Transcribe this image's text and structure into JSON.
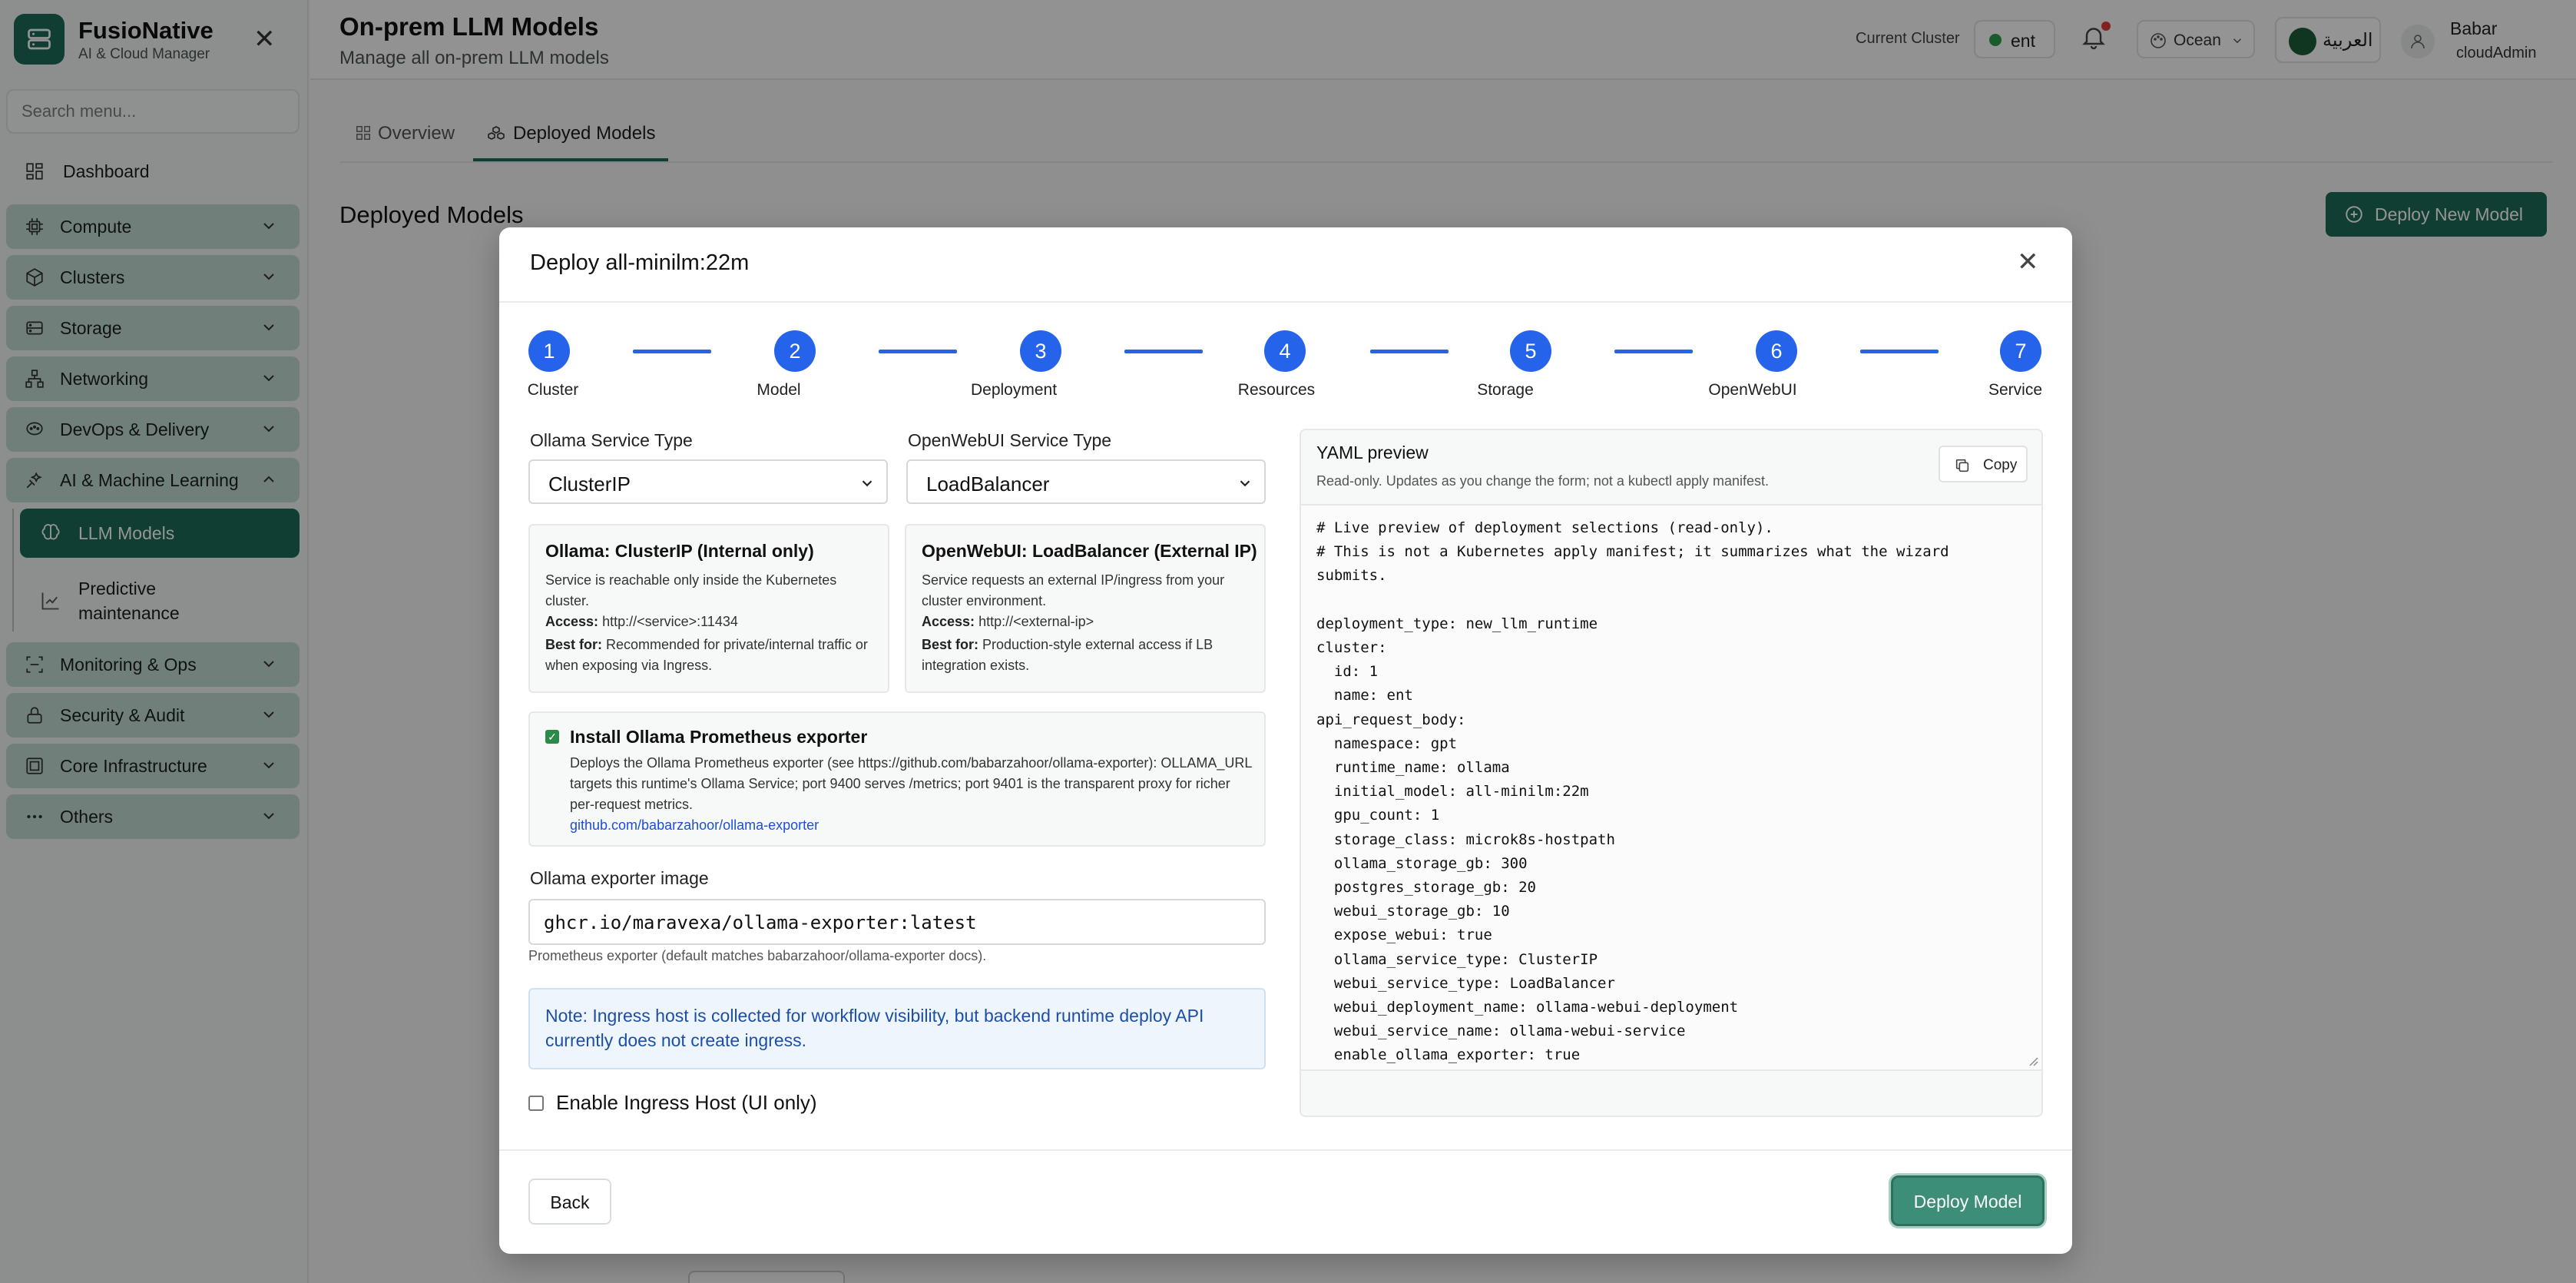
{
  "app": {
    "brand_name": "FusioNative",
    "brand_sub": "AI & Cloud Manager",
    "search_placeholder": "Search menu..."
  },
  "sidebar": {
    "dashboard": "Dashboard",
    "groups": [
      {
        "label": "Compute",
        "icon": "cpu-icon"
      },
      {
        "label": "Clusters",
        "icon": "cube-icon"
      },
      {
        "label": "Storage",
        "icon": "database-icon"
      },
      {
        "label": "Networking",
        "icon": "network-icon"
      },
      {
        "label": "DevOps & Delivery",
        "icon": "devops-icon"
      },
      {
        "label": "AI & Machine Learning",
        "icon": "ai-icon"
      },
      {
        "label": "Monitoring & Ops",
        "icon": "monitor-icon"
      },
      {
        "label": "Security & Audit",
        "icon": "lock-icon"
      },
      {
        "label": "Core Infrastructure",
        "icon": "server-icon"
      },
      {
        "label": "Others",
        "icon": "dots-icon"
      }
    ],
    "active_item": "LLM Models",
    "sub_item": "Predictive maintenance"
  },
  "header": {
    "title": "On-prem LLM Models",
    "subtitle": "Manage all on-prem LLM models",
    "current_cluster_label": "Current Cluster",
    "cluster_name": "ent",
    "theme": "Ocean",
    "language": "العربية",
    "user_name": "Babar",
    "user_role": "cloudAdmin"
  },
  "tabs": {
    "overview": "Overview",
    "deployed": "Deployed Models"
  },
  "main": {
    "section_title": "Deployed Models",
    "deploy_new": "Deploy New Model"
  },
  "modal": {
    "title": "Deploy all-minilm:22m",
    "steps": [
      "Cluster",
      "Model",
      "Deployment",
      "Resources",
      "Storage",
      "OpenWebUI",
      "Service"
    ],
    "step_numbers": [
      "1",
      "2",
      "3",
      "4",
      "5",
      "6",
      "7"
    ],
    "ollama_service_label": "Ollama Service Type",
    "ollama_service_value": "ClusterIP",
    "webui_service_label": "OpenWebUI Service Type",
    "webui_service_value": "LoadBalancer",
    "ollama_card": {
      "heading": "Ollama: ClusterIP (Internal only)",
      "desc": "Service is reachable only inside the Kubernetes cluster.",
      "access_label": "Access:",
      "access_value": "http://<service>:11434",
      "best_label": "Best for:",
      "best_value": "Recommended for private/internal traffic or when exposing via Ingress."
    },
    "webui_card": {
      "heading": "OpenWebUI: LoadBalancer (External IP)",
      "desc": "Service requests an external IP/ingress from your cluster environment.",
      "access_label": "Access:",
      "access_value": "http://<external-ip>",
      "best_label": "Best for:",
      "best_value": "Production-style external access if LB integration exists."
    },
    "exporter": {
      "label": "Install Ollama Prometheus exporter",
      "checked": true,
      "desc": "Deploys the Ollama Prometheus exporter (see https://github.com/babarzahoor/ollama-exporter): OLLAMA_URL targets this runtime's Ollama Service; port 9400 serves /metrics; port 9401 is the transparent proxy for richer per-request metrics.",
      "link": "github.com/babarzahoor/ollama-exporter"
    },
    "image_label": "Ollama exporter image",
    "image_value": "ghcr.io/maravexa/ollama-exporter:latest",
    "image_hint": "Prometheus exporter (default matches babarzahoor/ollama-exporter docs).",
    "note": "Note: Ingress host is collected for workflow visibility, but backend runtime deploy API currently does not create ingress.",
    "ingress_label": "Enable Ingress Host (UI only)",
    "ingress_checked": false,
    "yaml": {
      "title": "YAML preview",
      "subtitle": "Read-only. Updates as you change the form; not a kubectl apply manifest.",
      "copy": "Copy",
      "lines": [
        "# Live preview of deployment selections (read-only).",
        "# This is not a Kubernetes apply manifest; it summarizes what the wizard",
        "submits.",
        "",
        "deployment_type: new_llm_runtime",
        "cluster:",
        "  id: 1",
        "  name: ent",
        "api_request_body:",
        "  namespace: gpt",
        "  runtime_name: ollama",
        "  initial_model: all-minilm:22m",
        "  gpu_count: 1",
        "  storage_class: microk8s-hostpath",
        "  ollama_storage_gb: 300",
        "  postgres_storage_gb: 20",
        "  webui_storage_gb: 10",
        "  expose_webui: true",
        "  ollama_service_type: ClusterIP",
        "  webui_service_type: LoadBalancer",
        "  webui_deployment_name: ollama-webui-deployment",
        "  webui_service_name: ollama-webui-service",
        "  enable_ollama_exporter: true"
      ]
    },
    "back": "Back",
    "deploy": "Deploy Model"
  },
  "colors": {
    "brand": "#1e6b57",
    "step_blue": "#2563eb",
    "note_text": "#1d4fa6",
    "link": "#1d4ed8"
  }
}
